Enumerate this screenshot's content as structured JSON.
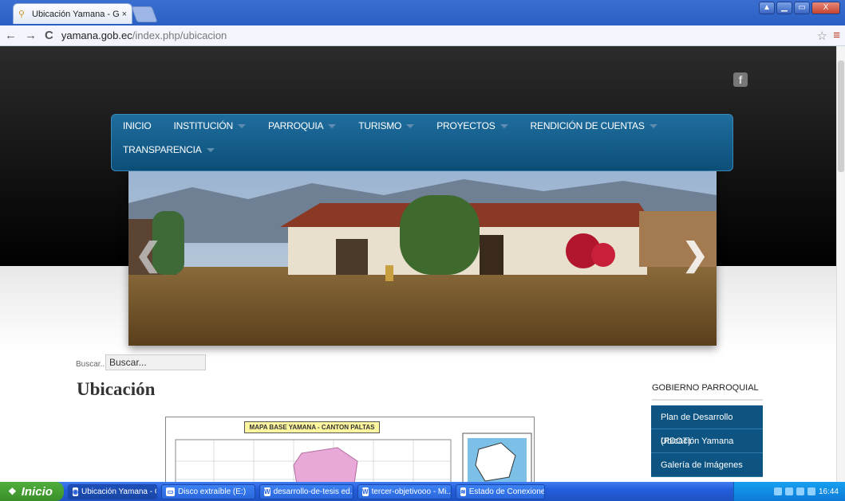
{
  "browser": {
    "tab_title": "Ubicación Yamana - Gobierno",
    "tab_close": "×",
    "url_host": "yamana.gob.ec",
    "url_path": "/index.php/ubicacion",
    "back": "←",
    "forward": "→",
    "reload": "C",
    "star": "☆",
    "menu": "≡",
    "win_min": "▁",
    "win_max": "▭",
    "win_close": "X"
  },
  "header": {
    "social_icon": "f"
  },
  "nav": {
    "items": [
      {
        "label": "INICIO",
        "caret": false
      },
      {
        "label": "INSTITUCIÓN",
        "caret": true
      },
      {
        "label": "PARROQUIA",
        "caret": true
      },
      {
        "label": "TURISMO",
        "caret": true
      },
      {
        "label": "PROYECTOS",
        "caret": true
      },
      {
        "label": "RENDICIÓN DE CUENTAS",
        "caret": true
      },
      {
        "label": "TRANSPARENCIA",
        "caret": true
      }
    ]
  },
  "slider": {
    "prev": "❮",
    "next": "❯"
  },
  "search": {
    "label": "Buscar...",
    "value": "Buscar..."
  },
  "main": {
    "title": "Ubicación",
    "map_title": "MAPA BASE  YAMANA - CANTON PALTAS"
  },
  "sidebar": {
    "heading": "GOBIERNO PARROQUIAL",
    "links": [
      "Plan de Desarrollo (PDOT)",
      "Ubicación Yamana",
      "Galería de Imágenes"
    ]
  },
  "taskbar": {
    "start": "Inicio",
    "tasks": [
      {
        "label": "Ubicación Yamana - G...",
        "icon": "chrome-icon",
        "active": true
      },
      {
        "label": "Disco extraíble (E:)",
        "icon": "drive-icon",
        "active": false
      },
      {
        "label": "desarrollo-de-tesis ed...",
        "icon": "word-icon",
        "active": false
      },
      {
        "label": "tercer-objetivooo - Mi...",
        "icon": "word-icon",
        "active": false
      },
      {
        "label": "Estado de Conexione...",
        "icon": "network-icon",
        "active": false
      }
    ],
    "clock": "16:44"
  },
  "colors": {
    "nav_bg": "#0c4f79",
    "sidebar_link_bg": "#0d5482",
    "taskbar_bg": "#245edb",
    "start_bg": "#3b8f2a"
  }
}
